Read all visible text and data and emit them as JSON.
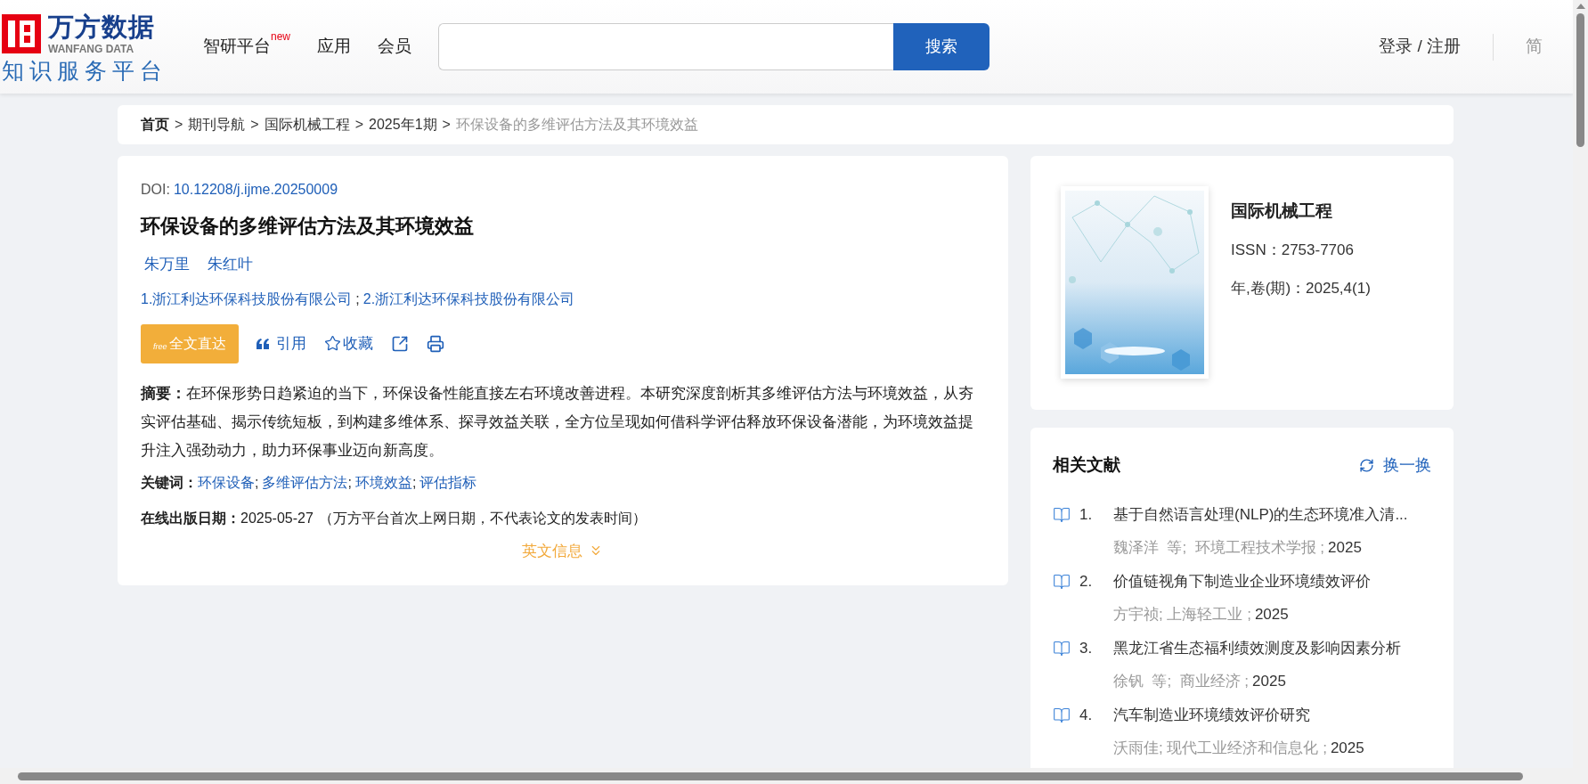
{
  "header": {
    "logo": {
      "brand": "万方数据",
      "brand_en": "WANFANG DATA",
      "subtitle": "知识服务平台"
    },
    "nav": [
      {
        "label": "智研平台",
        "badge": "new"
      },
      {
        "label": "应用"
      },
      {
        "label": "会员"
      }
    ],
    "search": {
      "button": "搜索"
    },
    "login": "登录 / 注册",
    "language": {
      "label": "简"
    }
  },
  "breadcrumb_separator": ">",
  "breadcrumb": [
    {
      "label": "首页",
      "kind": "home"
    },
    {
      "label": "期刊导航",
      "kind": "link"
    },
    {
      "label": "国际机械工程",
      "kind": "link"
    },
    {
      "label": "2025年1期",
      "kind": "link"
    },
    {
      "label": "环保设备的多维评估方法及其环境效益",
      "kind": "current"
    }
  ],
  "article": {
    "doi_label": "DOI:",
    "doi": "10.12208/j.ijme.20250009",
    "title": "环保设备的多维评估方法及其环境效益",
    "authors": [
      "朱万里",
      "朱红叶"
    ],
    "affiliation_separator": ";",
    "keyword_separator": ";",
    "affiliations": [
      "1.浙江利达环保科技股份有限公司",
      "2.浙江利达环保科技股份有限公司"
    ],
    "actions": [
      {
        "kind": "fulltext",
        "label": "全文直达",
        "badge": "free"
      },
      {
        "kind": "cite",
        "label": "引用"
      },
      {
        "kind": "favorite",
        "label": "收藏"
      },
      {
        "kind": "share"
      },
      {
        "kind": "print"
      }
    ],
    "abstract_label": "摘要：",
    "abstract": "在环保形势日趋紧迫的当下，环保设备性能直接左右环境改善进程。本研究深度剖析其多维评估方法与环境效益，从夯实评估基础、揭示传统短板，到构建多维体系、探寻效益关联，全方位呈现如何借科学评估释放环保设备潜能，为环境效益提升注入强劲动力，助力环保事业迈向新高度。",
    "keywords_label": "关键词：",
    "keywords": [
      "环保设备",
      "多维评估方法",
      "环境效益",
      "评估指标"
    ],
    "date_label": "在线出版日期：",
    "date": "2025-05-27",
    "date_note": "（万方平台首次上网日期，不代表论文的发表时间）",
    "english_toggle": "英文信息"
  },
  "journal": {
    "name": "国际机械工程",
    "issn": "ISSN：2753-7706",
    "volume": "年,卷(期)：2025,4(1)"
  },
  "related": {
    "title": "相关文献",
    "refresh": "换一换",
    "items": [
      {
        "number": "1.",
        "title": "基于自然语言处理(NLP)的生态环境准入清...",
        "meta": "魏泽洋  等;  环境工程技术学报 ;",
        "year": "2025"
      },
      {
        "number": "2.",
        "title": "价值链视角下制造业企业环境绩效评价",
        "meta": "方宇祯; 上海轻工业 ;",
        "year": "2025"
      },
      {
        "number": "3.",
        "title": "黑龙江省生态福利绩效测度及影响因素分析",
        "meta": "徐钒  等;  商业经济 ;",
        "year": "2025"
      },
      {
        "number": "4.",
        "title": "汽车制造业环境绩效评价研究",
        "meta": "沃雨佳; 现代工业经济和信息化 ;",
        "year": "2025"
      }
    ]
  }
}
